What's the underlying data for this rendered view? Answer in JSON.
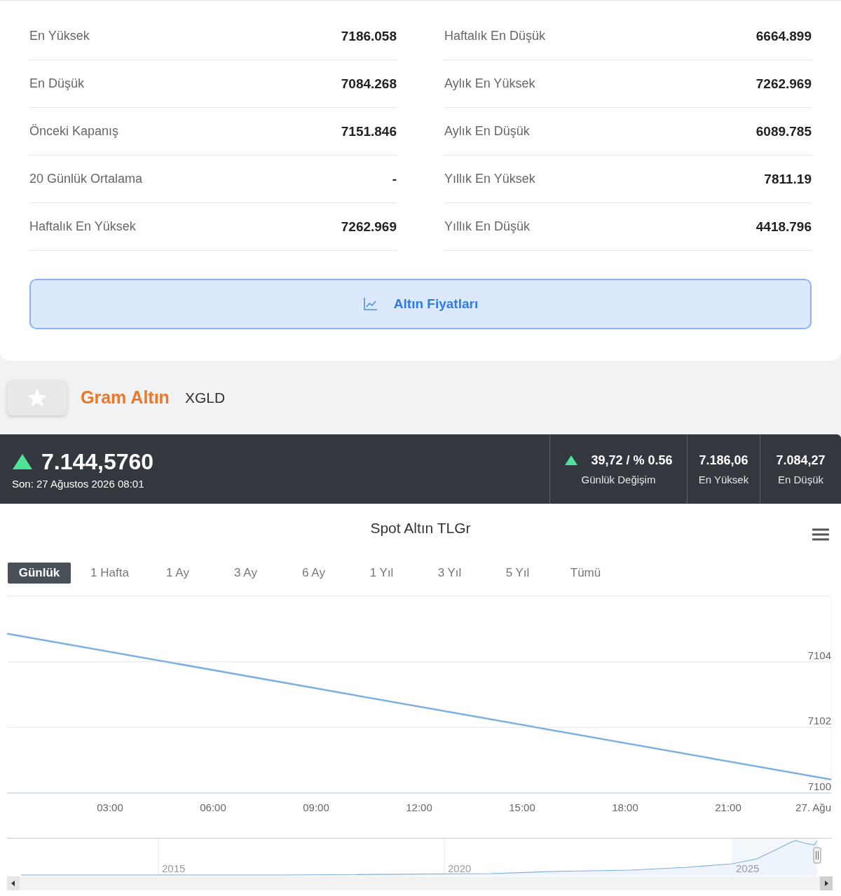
{
  "stats": {
    "left": [
      {
        "label": "En Yüksek",
        "value": "7186.058"
      },
      {
        "label": "En Düşük",
        "value": "7084.268"
      },
      {
        "label": "Önceki Kapanış",
        "value": "7151.846"
      },
      {
        "label": "20 Günlük Ortalama",
        "value": "-"
      },
      {
        "label": "Haftalık En Yüksek",
        "value": "7262.969"
      }
    ],
    "right": [
      {
        "label": "Haftalık En Düşük",
        "value": "6664.899"
      },
      {
        "label": "Aylık En Yüksek",
        "value": "7262.969"
      },
      {
        "label": "Aylık En Düşük",
        "value": "6089.785"
      },
      {
        "label": "Yıllık En Yüksek",
        "value": "7811.19"
      },
      {
        "label": "Yıllık En Düşük",
        "value": "4418.796"
      }
    ]
  },
  "prices_button": "Altın Fiyatları",
  "instrument": {
    "name": "Gram Altın",
    "code": "XGLD"
  },
  "quote": {
    "rising": true,
    "price": "7.144,5760",
    "updated": "Son: 27 Ağustos 2026 08:01",
    "change": {
      "rising": true,
      "value": "39,72 / % 0.56",
      "label": "Günlük Değişim"
    },
    "high": {
      "value": "7.186,06",
      "label": "En Yüksek"
    },
    "low": {
      "value": "7.084,27",
      "label": "En Düşük"
    }
  },
  "chart": {
    "title": "Spot Altın TLGr",
    "ranges": [
      {
        "label": "Günlük",
        "selected": true
      },
      {
        "label": "1 Hafta",
        "selected": false
      },
      {
        "label": "1 Ay",
        "selected": false
      },
      {
        "label": "3 Ay",
        "selected": false
      },
      {
        "label": "6 Ay",
        "selected": false
      },
      {
        "label": "1 Yıl",
        "selected": false
      },
      {
        "label": "3 Yıl",
        "selected": false
      },
      {
        "label": "5 Yıl",
        "selected": false
      },
      {
        "label": "Tümü",
        "selected": false
      }
    ],
    "chart_data": {
      "type": "line",
      "x": [
        0,
        24
      ],
      "xlim": [
        0,
        24
      ],
      "ylim": [
        7100,
        7106
      ],
      "xticks": [
        {
          "value": 3,
          "label": "03:00"
        },
        {
          "value": 6,
          "label": "06:00"
        },
        {
          "value": 9,
          "label": "09:00"
        },
        {
          "value": 12,
          "label": "12:00"
        },
        {
          "value": 15,
          "label": "15:00"
        },
        {
          "value": 18,
          "label": "18:00"
        },
        {
          "value": 21,
          "label": "21:00"
        }
      ],
      "yticks": [
        7100,
        7102,
        7104
      ],
      "series": [
        {
          "color": "#7cb0de",
          "values": [
            7104.86,
            7100.41
          ]
        }
      ]
    },
    "end_date_label": "27. Ağu",
    "navigator_years": [
      "2015",
      "2020",
      "2025"
    ]
  }
}
